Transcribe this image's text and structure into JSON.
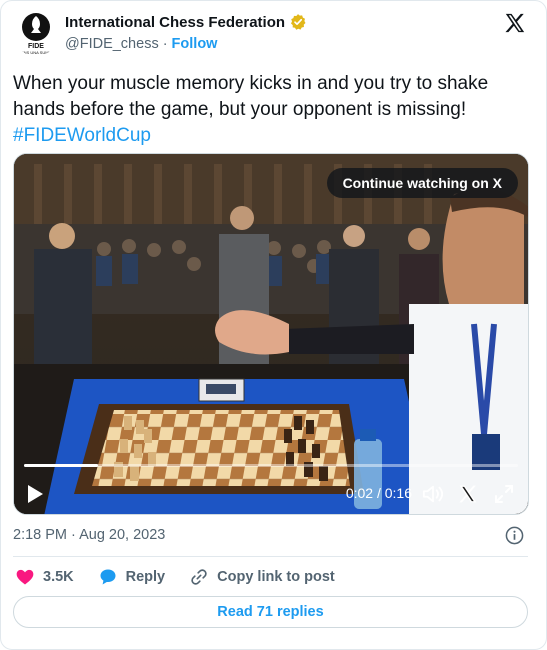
{
  "author": {
    "name": "International Chess Federation",
    "handle": "@FIDE_chess",
    "separator": "·",
    "follow_label": "Follow",
    "logo_text": "FIDE",
    "logo_motto": "GENS UNA SUMUS"
  },
  "tweet": {
    "text": "When your muscle memory kicks in and you try to shake hands before the game, but your opponent is missing!",
    "hashtag": "#FIDEWorldCup"
  },
  "video": {
    "continue_label": "Continue watching on X",
    "timecode": "0:02 / 0:16",
    "progress": 0.15
  },
  "meta": {
    "timestamp": "2:18 PM · Aug 20, 2023"
  },
  "actions": {
    "likes": "3.5K",
    "reply_label": "Reply",
    "copy_label": "Copy link to post"
  },
  "footer": {
    "read_replies": "Read 71 replies"
  },
  "colors": {
    "accent": "#1d9bf0",
    "like": "#f91880",
    "verified": "#e2b719"
  },
  "icons": [
    "fide-logo-icon",
    "verified-gold-icon",
    "x-logo-icon",
    "play-icon",
    "volume-icon",
    "x-small-icon",
    "fullscreen-icon",
    "info-icon",
    "heart-icon",
    "reply-bubble-icon",
    "link-icon"
  ]
}
